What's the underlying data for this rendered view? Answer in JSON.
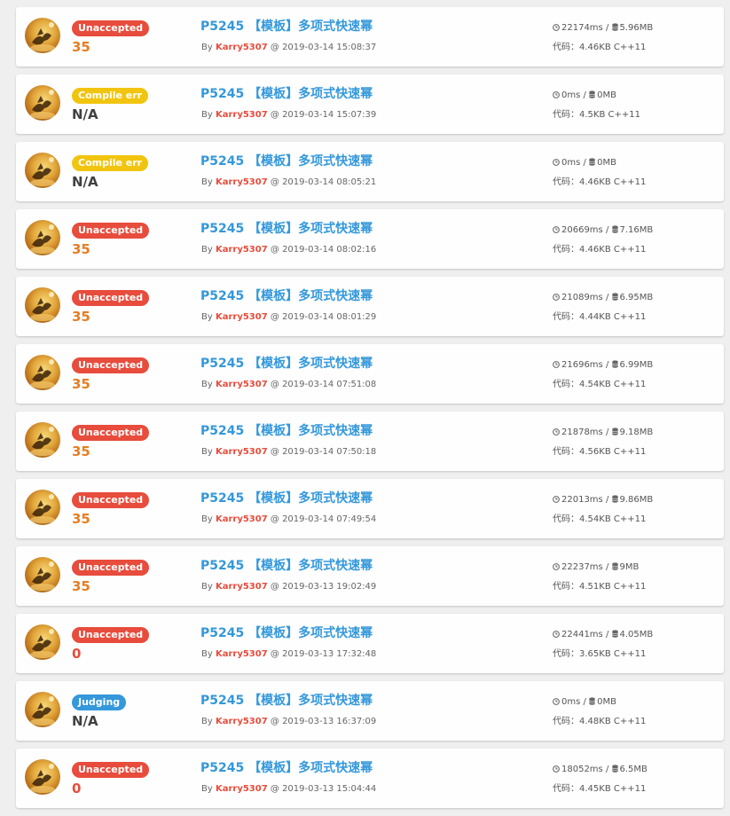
{
  "labels": {
    "by": "By",
    "at": "@",
    "code_prefix": "代码：",
    "stat_separator": "/"
  },
  "colors": {
    "unaccepted": "#e74c3c",
    "compile_error": "#f1c40f",
    "judging": "#3498db",
    "score_partial": "#e67e22",
    "score_zero": "#e74c3c",
    "score_na": "#404040",
    "problem_link": "#3498db",
    "username": "#e74c3c"
  },
  "icons": {
    "time": "clock-icon",
    "memory": "database-icon"
  },
  "records": [
    {
      "status": "Unaccepted",
      "status_type": "unacc",
      "score": "35",
      "score_type": "orange",
      "problem": "P5245 【模板】多项式快速幂",
      "user": "Karry5307",
      "time": "2019-03-14 15:08:37",
      "runtime": "22174ms",
      "memory": "5.96MB",
      "code_size": "4.46KB",
      "language": "C++11"
    },
    {
      "status": "Compile err",
      "status_type": "ce",
      "score": "N/A",
      "score_type": "gray",
      "problem": "P5245 【模板】多项式快速幂",
      "user": "Karry5307",
      "time": "2019-03-14 15:07:39",
      "runtime": "0ms",
      "memory": "0MB",
      "code_size": "4.5KB",
      "language": "C++11"
    },
    {
      "status": "Compile err",
      "status_type": "ce",
      "score": "N/A",
      "score_type": "gray",
      "problem": "P5245 【模板】多项式快速幂",
      "user": "Karry5307",
      "time": "2019-03-14 08:05:21",
      "runtime": "0ms",
      "memory": "0MB",
      "code_size": "4.46KB",
      "language": "C++11"
    },
    {
      "status": "Unaccepted",
      "status_type": "unacc",
      "score": "35",
      "score_type": "orange",
      "problem": "P5245 【模板】多项式快速幂",
      "user": "Karry5307",
      "time": "2019-03-14 08:02:16",
      "runtime": "20669ms",
      "memory": "7.16MB",
      "code_size": "4.46KB",
      "language": "C++11"
    },
    {
      "status": "Unaccepted",
      "status_type": "unacc",
      "score": "35",
      "score_type": "orange",
      "problem": "P5245 【模板】多项式快速幂",
      "user": "Karry5307",
      "time": "2019-03-14 08:01:29",
      "runtime": "21089ms",
      "memory": "6.95MB",
      "code_size": "4.44KB",
      "language": "C++11"
    },
    {
      "status": "Unaccepted",
      "status_type": "unacc",
      "score": "35",
      "score_type": "orange",
      "problem": "P5245 【模板】多项式快速幂",
      "user": "Karry5307",
      "time": "2019-03-14 07:51:08",
      "runtime": "21696ms",
      "memory": "6.99MB",
      "code_size": "4.54KB",
      "language": "C++11"
    },
    {
      "status": "Unaccepted",
      "status_type": "unacc",
      "score": "35",
      "score_type": "orange",
      "problem": "P5245 【模板】多项式快速幂",
      "user": "Karry5307",
      "time": "2019-03-14 07:50:18",
      "runtime": "21878ms",
      "memory": "9.18MB",
      "code_size": "4.56KB",
      "language": "C++11"
    },
    {
      "status": "Unaccepted",
      "status_type": "unacc",
      "score": "35",
      "score_type": "orange",
      "problem": "P5245 【模板】多项式快速幂",
      "user": "Karry5307",
      "time": "2019-03-14 07:49:54",
      "runtime": "22013ms",
      "memory": "9.86MB",
      "code_size": "4.54KB",
      "language": "C++11"
    },
    {
      "status": "Unaccepted",
      "status_type": "unacc",
      "score": "35",
      "score_type": "orange",
      "problem": "P5245 【模板】多项式快速幂",
      "user": "Karry5307",
      "time": "2019-03-13 19:02:49",
      "runtime": "22237ms",
      "memory": "9MB",
      "code_size": "4.51KB",
      "language": "C++11"
    },
    {
      "status": "Unaccepted",
      "status_type": "unacc",
      "score": "0",
      "score_type": "red",
      "problem": "P5245 【模板】多项式快速幂",
      "user": "Karry5307",
      "time": "2019-03-13 17:32:48",
      "runtime": "22441ms",
      "memory": "4.05MB",
      "code_size": "3.65KB",
      "language": "C++11"
    },
    {
      "status": "Judging",
      "status_type": "judge",
      "score": "N/A",
      "score_type": "gray",
      "problem": "P5245 【模板】多项式快速幂",
      "user": "Karry5307",
      "time": "2019-03-13 16:37:09",
      "runtime": "0ms",
      "memory": "0MB",
      "code_size": "4.48KB",
      "language": "C++11"
    },
    {
      "status": "Unaccepted",
      "status_type": "unacc",
      "score": "0",
      "score_type": "red",
      "problem": "P5245 【模板】多项式快速幂",
      "user": "Karry5307",
      "time": "2019-03-13 15:04:44",
      "runtime": "18052ms",
      "memory": "6.5MB",
      "code_size": "4.45KB",
      "language": "C++11"
    }
  ]
}
